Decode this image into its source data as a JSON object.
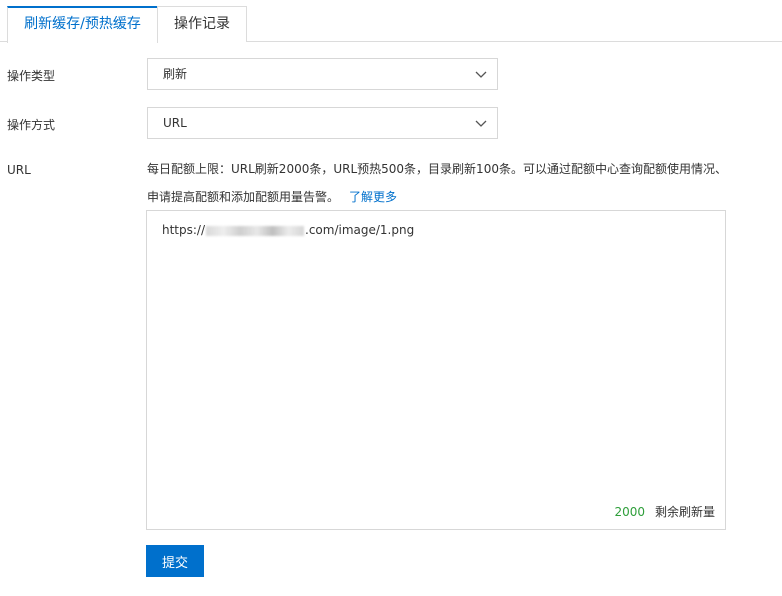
{
  "tabs": [
    {
      "label": "刷新缓存/预热缓存",
      "active": true
    },
    {
      "label": "操作记录",
      "active": false
    }
  ],
  "form": {
    "operation_type": {
      "label": "操作类型",
      "value": "刷新"
    },
    "operation_method": {
      "label": "操作方式",
      "value": "URL"
    },
    "url": {
      "label": "URL",
      "help_text": "每日配额上限：URL刷新2000条，URL预热500条，目录刷新100条。可以通过配额中心查询配额使用情况、申请提高配额和添加配额用量告警。",
      "help_link": "了解更多",
      "input_prefix": "https://",
      "input_suffix": ".com/image/1.png",
      "remaining_count": "2000",
      "remaining_label": "剩余刷新量"
    },
    "submit_label": "提交"
  },
  "colors": {
    "accent": "#0070cc",
    "counter": "#2e9e3a",
    "border": "#d7d7d7"
  }
}
